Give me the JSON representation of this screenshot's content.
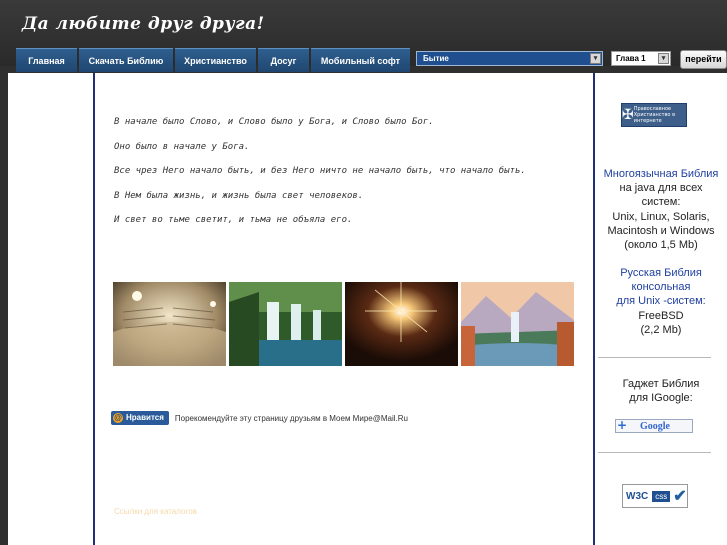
{
  "site": {
    "title": "Да любите друг друга!"
  },
  "nav": [
    {
      "label": "Главная"
    },
    {
      "label": "Скачать Библию"
    },
    {
      "label": "Христианство"
    },
    {
      "label": "Досуг"
    },
    {
      "label": "Мобильный софт"
    }
  ],
  "search": {
    "book_value": "Бытие",
    "chapter_value": "Глава 1",
    "go_label": "перейти"
  },
  "verses": [
    "В начале было Слово, и Слово было у Бога, и Слово было Бог.",
    "Оно было в начале у Бога.",
    "Все чрез Него начало быть, и без Него ничто не начало быть, что начало быть.",
    "В Нем была жизнь, и жизнь была свет человеков.",
    "И свет во тьме светит, и тьма не объяла его."
  ],
  "like": {
    "button_label": "Нравится",
    "text": "Порекомендуйте эту страницу друзьям в Моем Мире@Mail.Ru"
  },
  "catalog_link": "Ссылки для каталогов",
  "sidebar": {
    "ortho_logo_text": "Православное Христианство в интернете",
    "java_bible": {
      "title": "Многоязычная Библия",
      "line1": "на java для всех",
      "line2": "систем:",
      "line3": "Unix, Linux, Solaris,",
      "line4": "Macintosh и Windows",
      "size": "(около 1,5 Mb)"
    },
    "console_bible": {
      "line1": "Русская Библия",
      "line2": "консольная",
      "line3": "для Unix -систем:",
      "os": "FreeBSD",
      "size": "(2,2 Mb)"
    },
    "gadget": {
      "line1": "Гаджет Библия",
      "line2": "для IGoogle:",
      "google_logo": "Google"
    },
    "w3c": {
      "w3": "W3C",
      "css": "css"
    }
  },
  "colors": {
    "nav_bg": "#1f4670",
    "divider": "#1f2f7a",
    "link_blue": "#1f3fa0"
  }
}
